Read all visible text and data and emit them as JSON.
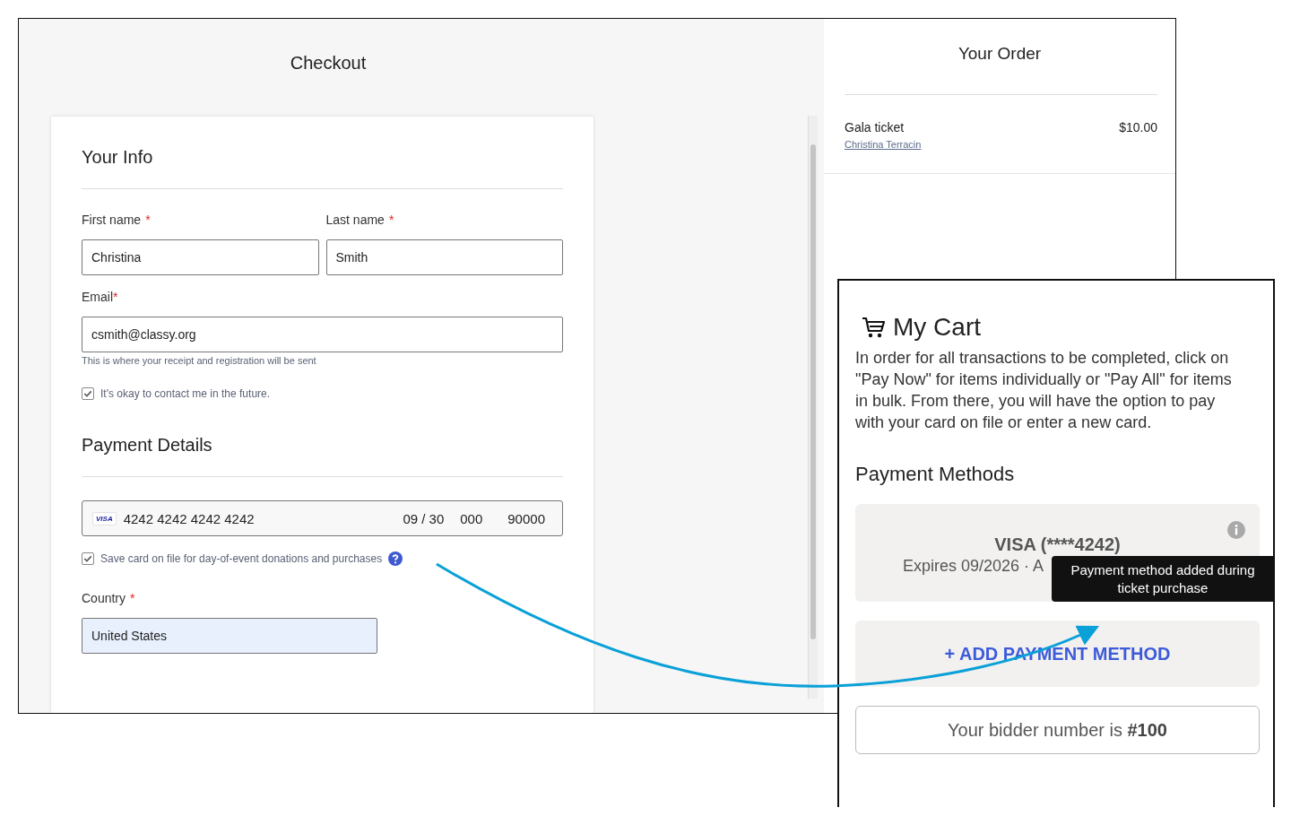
{
  "checkout": {
    "title": "Checkout",
    "info": {
      "heading": "Your Info",
      "first_name": {
        "label": "First name",
        "required_mark": "*",
        "value": "Christina"
      },
      "last_name": {
        "label": "Last name",
        "required_mark": "*",
        "value": "Smith"
      },
      "email": {
        "label": "Email",
        "required_mark": "*",
        "value": "csmith@classy.org",
        "hint": "This is where your receipt and registration will be sent"
      },
      "contact": {
        "label": "It's okay to contact me in the future.",
        "checked": true
      }
    },
    "payment": {
      "heading": "Payment Details",
      "card_brand": "VISA",
      "card_number": "4242 4242 4242 4242",
      "expiry": "09 / 30",
      "cvc": "000",
      "zip": "90000",
      "save_card": {
        "label": "Save card on file for day-of-event donations and purchases",
        "checked": true
      },
      "country": {
        "label": "Country",
        "required_mark": "*",
        "value": "United States"
      }
    }
  },
  "order": {
    "title": "Your Order",
    "items": [
      {
        "name": "Gala ticket",
        "attendee": "Christina Terracin",
        "price": "$10.00"
      }
    ]
  },
  "cart": {
    "title": "My Cart",
    "intro": "In order for all transactions to be completed, click on \"Pay Now\" for items individually or \"Pay All\" for items in bulk. From there, you will have the option to pay with your card on file or enter a new card.",
    "methods_heading": "Payment Methods",
    "methods": [
      {
        "title": "VISA (****4242)",
        "detail": "Expires 09/2026 · A"
      }
    ],
    "tooltip": "Payment method added during ticket purchase",
    "add_button": "+ ADD PAYMENT METHOD",
    "bidder": "Your bidder number is **#100**"
  }
}
